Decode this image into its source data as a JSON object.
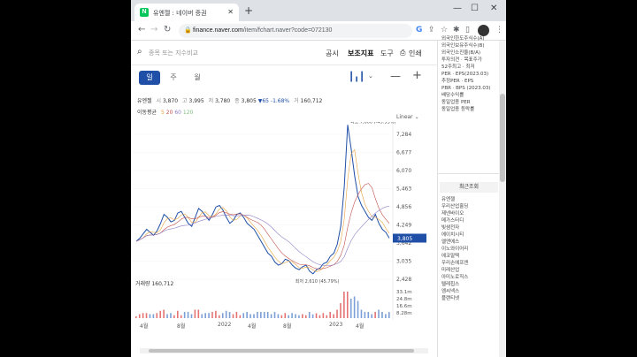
{
  "browser": {
    "tab_title": "유엔젤 : 네이버 증권",
    "url_host": "finance.naver.com",
    "url_path": "/item/fchart.naver?code=072130"
  },
  "toolbar": {
    "search_placeholder": "종목 또는 지수비교",
    "menu": [
      "공시",
      "보조지표",
      "도구",
      "인쇄"
    ]
  },
  "periods": [
    "일",
    "주",
    "월"
  ],
  "quote": {
    "name": "유엔젤",
    "open_label": "시",
    "open": "3,870",
    "high_label": "고",
    "high": "3,995",
    "low_label": "저",
    "low": "3,780",
    "close_label": "종",
    "close": "3,805",
    "change": "▼65",
    "change_pct": "-1.68%",
    "volume_label": "거",
    "volume": "160,712"
  },
  "ma": {
    "label": "이동평균",
    "p5": "5",
    "p20": "20",
    "p60": "60",
    "p120": "120"
  },
  "scale_label": "Linear",
  "chart_data": {
    "type": "line",
    "y_ticks": [
      "7,284",
      "6,677",
      "6,070",
      "5,463",
      "4,856",
      "4,249",
      "3,642",
      "3,035",
      "2,428"
    ],
    "ylim": [
      2428,
      7284
    ],
    "current_price_label": "3,805",
    "current_price": 3805,
    "high_annotation": "최고 7,600 (-49.93%)",
    "low_annotation": "최저 2,610 (45.79%)",
    "x_tick_labels": [
      "4월",
      "8월",
      "2022",
      "4월",
      "8월",
      "2023",
      "4월"
    ],
    "volume_header_label": "거래량",
    "volume_header_value": "160,712",
    "volume_ticks": [
      "33.1m",
      "24.8m",
      "16.6m",
      "8.28m"
    ],
    "series": [
      {
        "values": [
          3700,
          3800,
          3950,
          4100,
          4000,
          3900,
          4050,
          4300,
          4600,
          4500,
          4350,
          4400,
          4650,
          4700,
          4500,
          4300,
          4200,
          4500,
          4800,
          4700,
          4550,
          4400,
          4600,
          4850,
          4900,
          4750,
          4500,
          4300,
          4400,
          4600,
          4650,
          4500,
          4300,
          4200,
          4100,
          3900,
          3700,
          3500,
          3300,
          3200,
          3000,
          2900,
          2950,
          3100,
          3050,
          2900,
          2800,
          2750,
          2850,
          2900,
          2700,
          2610,
          2750,
          2800,
          2950,
          3000,
          3200,
          3300,
          3600,
          4200,
          5500,
          7600,
          6800,
          5900,
          5200,
          4900,
          4700,
          4500,
          4400,
          4600,
          4300,
          4100,
          4000,
          3805
        ]
      }
    ]
  },
  "sidepanel": {
    "top_items": [
      "외국인한도주식수(A)",
      "외국인보유주식수(B)",
      "외국인소진율(B/A)",
      "투자의견 · 목표주가",
      "52주최고 · 최저",
      "PER · EPS(2023.03)",
      "추정PER · EPS",
      "PBR · BPS (2023.03)",
      "배당수익률",
      "동일업종 PER",
      "동일업종 등락률"
    ],
    "recent_header": "최근조회",
    "recent_items": [
      "유엔젤",
      "우리산업홀딩",
      "제넨바이오",
      "메가스터디",
      "빛샘전자",
      "에이치시티",
      "엘앤에스",
      "이노와이어리",
      "에코말텍",
      "우리손에프앤",
      "미래산업",
      "아미노로직스",
      "텔레칩스",
      "엠씨넥스",
      "플랜티넷"
    ]
  }
}
